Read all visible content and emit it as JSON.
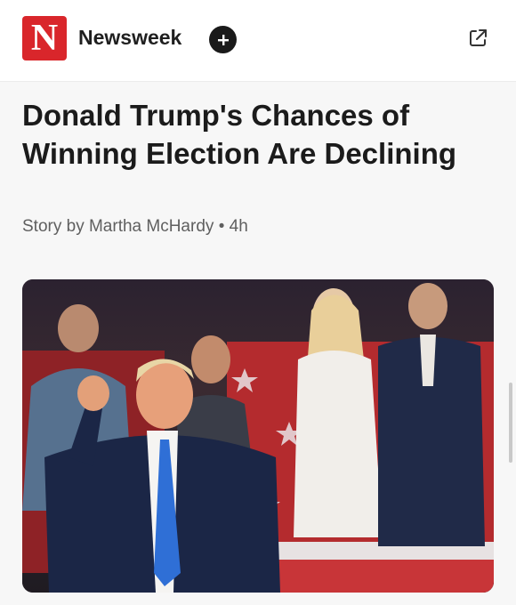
{
  "header": {
    "logo_letter": "N",
    "brand_name": "Newsweek",
    "follow_icon": "plus-circle-icon",
    "share_icon": "external-link-icon"
  },
  "article": {
    "headline": "Donald Trump's Chances of Winning Election Are Declining",
    "byline_author": "Story by Martha McHardy",
    "byline_separator": "•",
    "byline_age": "4h"
  },
  "colors": {
    "brand_red": "#d9262b",
    "text_dark": "#1b1b1b",
    "text_muted": "#5f5f5f"
  }
}
